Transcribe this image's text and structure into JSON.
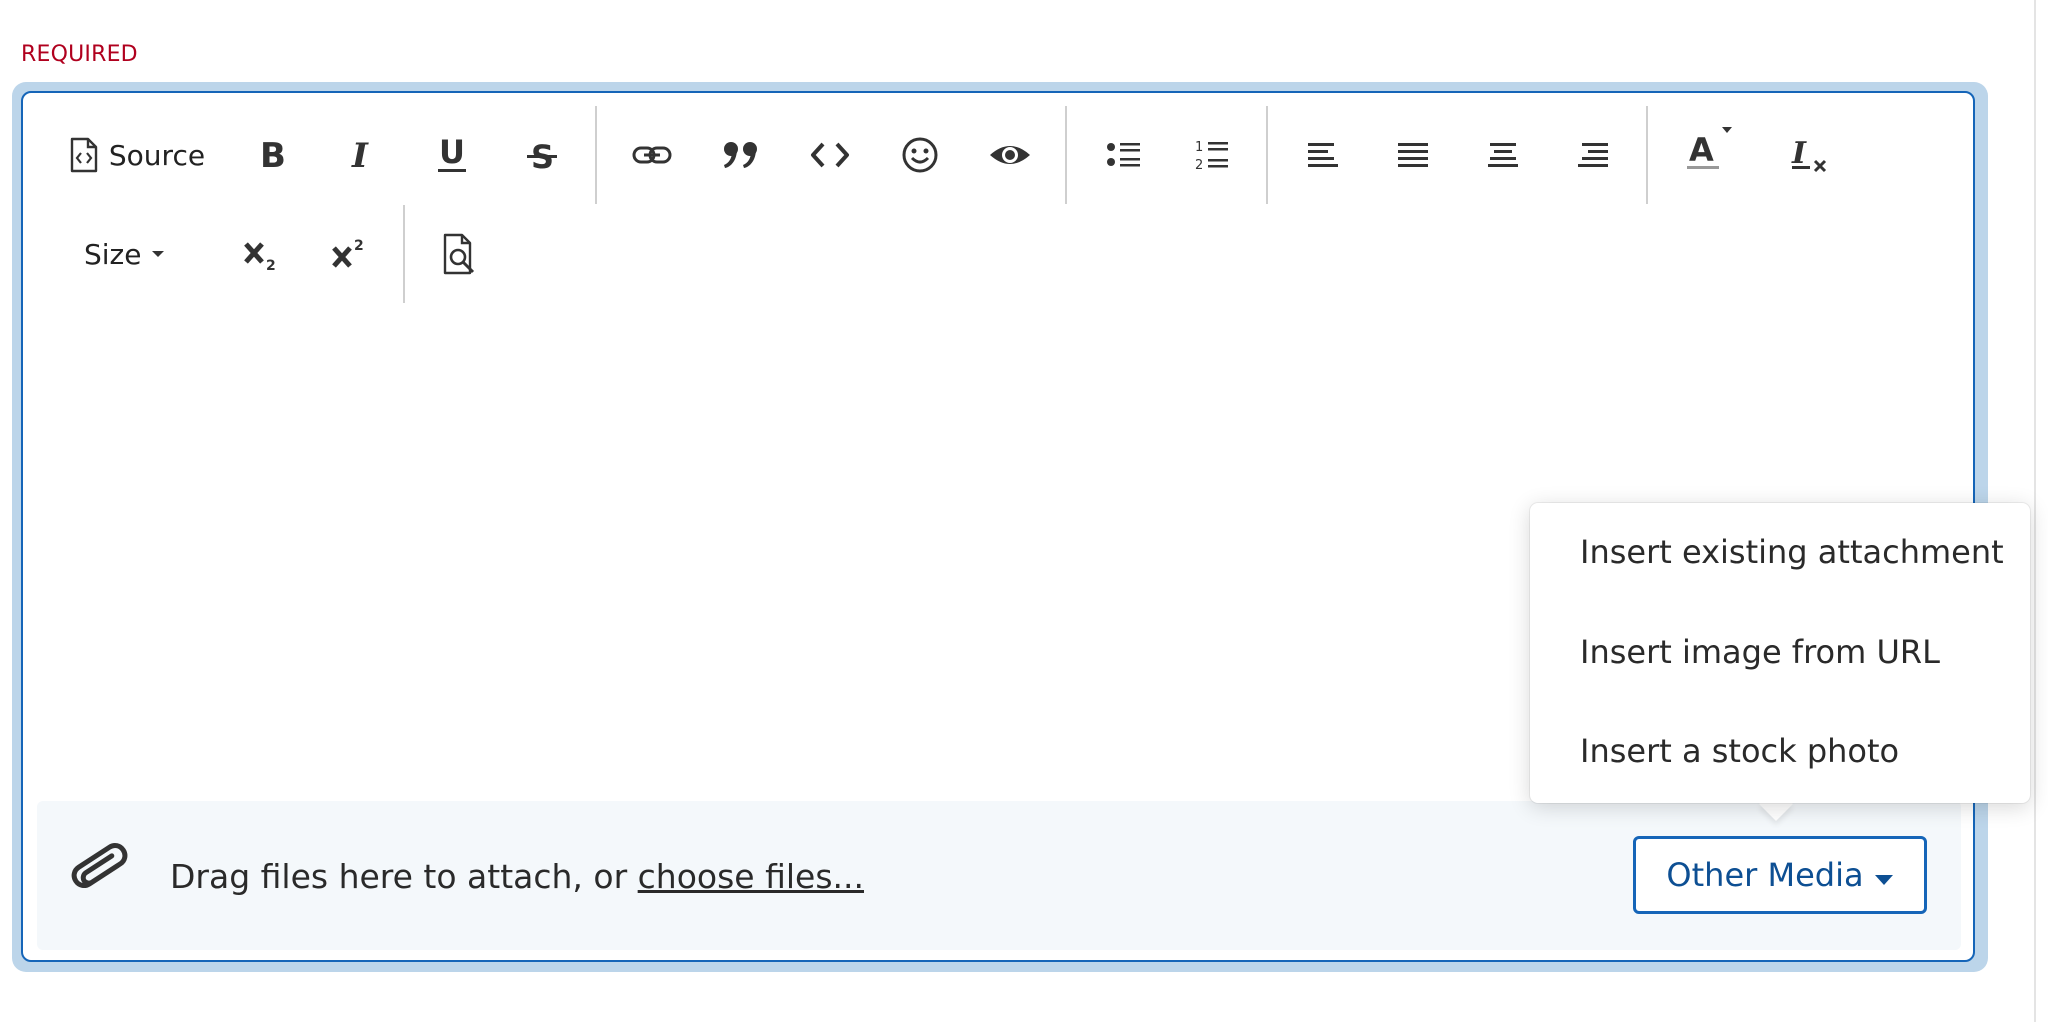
{
  "field": {
    "required_label": "REQUIRED"
  },
  "toolbar": {
    "source_label": "Source",
    "size_label": "Size"
  },
  "footer": {
    "drag_text": "Drag files here to attach, or ",
    "choose_files_link": "choose files...",
    "other_media_label": "Other Media"
  },
  "other_media_menu": {
    "items": [
      {
        "label": "Insert existing attachment"
      },
      {
        "label": "Insert image from URL"
      },
      {
        "label": "Insert a stock photo"
      }
    ]
  },
  "colors": {
    "required": "#b0001e",
    "accent": "#1565b8",
    "focus_ring": "#bcd5ea",
    "footer_bg": "#f4f8fb"
  },
  "icons": [
    "source-icon",
    "bold-icon",
    "italic-icon",
    "underline-icon",
    "strikethrough-icon",
    "link-icon",
    "blockquote-icon",
    "code-icon",
    "emoji-icon",
    "preview-eye-icon",
    "bulleted-list-icon",
    "numbered-list-icon",
    "align-left-icon",
    "justify-icon",
    "align-center-icon",
    "align-right-icon",
    "text-color-icon",
    "remove-format-icon",
    "subscript-icon",
    "superscript-icon",
    "find-icon",
    "paperclip-icon",
    "caret-down-icon"
  ]
}
